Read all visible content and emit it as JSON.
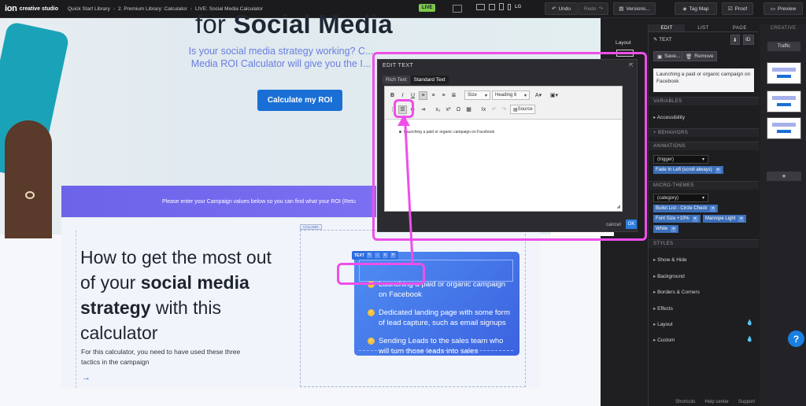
{
  "topbar": {
    "logo": "ion",
    "brand": "creative studio",
    "crumbs": [
      "Quick Start Library",
      "2. Premium Library: Calculator",
      "LIVE: Social Media Calculator"
    ],
    "live_badge": "LIVE",
    "device_lg": "LG",
    "undo": "Undo",
    "redo": "Redo",
    "versions": "Versions...",
    "tag_map": "Tag Map",
    "proof": "Proof",
    "preview": "Preview"
  },
  "hero": {
    "title_light": "for ",
    "title_bold": "Social Media",
    "subtitle": "Is your social media strategy working? C... Media ROI Calculator will give you the I...",
    "cta": "Calculate my ROI",
    "banner": "Please enter your Campaign values below so you can find what your ROI (Retu"
  },
  "section": {
    "column_tag": "COLUMN",
    "heading_a": "How to get the most out of your ",
    "heading_bold": "social media strategy",
    "heading_b": " with this calculator",
    "desc": "For this calculator, you need to have used these three tactics in the campaign",
    "arrow": "→",
    "text_chip": "TEXT",
    "bullets": [
      "Launching a paid or organic campaign on Facebook",
      "Dedicated landing page with some form of lead capture, such as email signups",
      "Sending Leads to the sales team who will turn those leads into sales"
    ]
  },
  "modal": {
    "title": "EDIT TEXT",
    "tab_rich": "Rich Text",
    "tab_standard": "Standard Text",
    "size_label": "Size",
    "heading_label": "Heading 6",
    "source_label": "Source",
    "content_bullet": "Launching a paid or organic campaign on Facebook",
    "cancel": "cancel",
    "ok": "OK"
  },
  "layout_label": "Layout",
  "panel": {
    "tabs": [
      "EDIT",
      "LIST",
      "PAGE"
    ],
    "element_label": "TEXT",
    "save": "Save...",
    "remove": "Remove",
    "preview_text": "Launching a paid or organic campaign on Facebook",
    "variables": "VARIABLES",
    "accessibility": "Accessibility",
    "behaviors": "+ BEHAVIORS",
    "animations": "ANIMATIONS",
    "trigger": "(trigger)",
    "anim_chip": "Fade In Left (scroll always)",
    "micro_themes": "MICRO-THEMES",
    "category": "(category)",
    "theme_chips": [
      "Bullet List - Circle Check",
      "Font Size +10%",
      "Manrope Light",
      "White"
    ],
    "styles": "STYLES",
    "style_items": [
      "Show & Hide",
      "Background",
      "Borders & Corners",
      "Effects",
      "Layout",
      "Custom"
    ]
  },
  "creative": {
    "header": "CREATIVE",
    "traffic": "Traffic",
    "add": "+"
  },
  "footer": [
    "Shortcuts",
    "Help center",
    "Support"
  ],
  "help": "?",
  "colors": {
    "accent_pink": "#ee4fe9",
    "brand_blue": "#1a6fd6",
    "live_green": "#7ec84a"
  }
}
